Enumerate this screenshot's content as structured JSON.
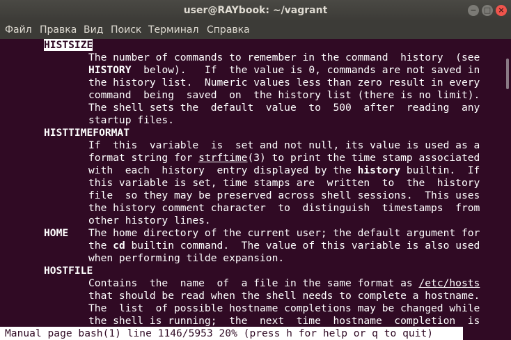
{
  "window": {
    "title": "user@RAYbook: ~/vagrant",
    "minimize_glyph": "−",
    "maximize_glyph": "□",
    "close_glyph": "×"
  },
  "menu": [
    "Файл",
    "Правка",
    "Вид",
    "Поиск",
    "Терминал",
    "Справка"
  ],
  "content": {
    "histsize_label": "HISTSIZE",
    "histsize_l1": "The number of commands to remember in the command  history  (see",
    "histsize_l2_a": "HISTORY",
    "histsize_l2_b": "  below).   If  the value is 0, commands are not saved in",
    "histsize_l3": "the history list.  Numeric values less than zero result in every",
    "histsize_l4": "command  being  saved  on  the history list (there is no limit).",
    "histsize_l5": "The shell sets the  default  value  to  500  after  reading  any",
    "histsize_l6": "startup files.",
    "histtimeformat_label": "HISTTIMEFORMAT",
    "htf_l1": "If  this  variable  is  set and not null, its value is used as a",
    "htf_l2_a": "format string for ",
    "htf_l2_link": "strftime",
    "htf_l2_b": "(3) to print the time stamp associated",
    "htf_l3_a": "with  each  history  entry displayed by the ",
    "htf_l3_bold": "history",
    "htf_l3_b": " builtin.  If",
    "htf_l4": "this variable is set, time stamps are  written  to  the  history",
    "htf_l5": "file  so they may be preserved across shell sessions.  This uses",
    "htf_l6": "the history comment character  to  distinguish  timestamps  from",
    "htf_l7": "other history lines.",
    "home_label": "HOME",
    "home_l1": "The home directory of the current user; the default argument for",
    "home_l2_a": "the ",
    "home_l2_bold": "cd",
    "home_l2_b": " builtin command.  The value of this variable is also used",
    "home_l3": "when performing tilde expansion.",
    "hostfile_label": "HOSTFILE",
    "hf_l1_a": "Contains  the  name  of  a file in the same format as ",
    "hf_l1_link": "/etc/hosts",
    "hf_l2": "that should be read when the shell needs to complete a hostname.",
    "hf_l3": "The  list  of possible hostname completions may be changed while",
    "hf_l4": "the shell is running;  the  next  time  hostname  completion  is"
  },
  "status_line": "Manual page bash(1) line 1146/5953 20% (press h for help or q to quit)"
}
